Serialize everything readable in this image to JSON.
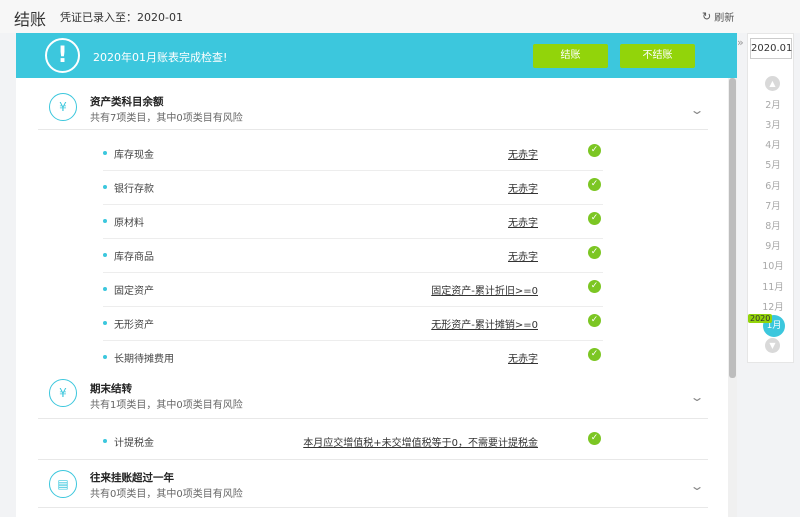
{
  "header": {
    "title": "结账",
    "voucher_info": "凭证已录入至：2020-01",
    "refresh_label": "刷新"
  },
  "banner": {
    "message": "2020年01月账表完成检查!",
    "close_label": "结账",
    "no_close_label": "不结账"
  },
  "sections": [
    {
      "title": "资产类科目余额",
      "subtitle": "共有7项类目，其中0项类目有风险",
      "icon": "yen-icon",
      "items": [
        {
          "name": "库存现金",
          "result": "无赤字"
        },
        {
          "name": "银行存款",
          "result": "无赤字"
        },
        {
          "name": "原材料",
          "result": "无赤字"
        },
        {
          "name": "库存商品",
          "result": "无赤字"
        },
        {
          "name": "固定资产",
          "result": "固定资产-累计折旧>=0"
        },
        {
          "name": "无形资产",
          "result": "无形资产-累计摊销>=0"
        },
        {
          "name": "长期待摊费用",
          "result": "无赤字"
        }
      ]
    },
    {
      "title": "期末结转",
      "subtitle": "共有1项类目，其中0项类目有风险",
      "icon": "transfer-icon",
      "items": [
        {
          "name": "计提税金",
          "result": "本月应交增值税+未交增值税等于0，不需要计提税金"
        }
      ]
    },
    {
      "title": "往来挂账超过一年",
      "subtitle": "共有0项类目，其中0项类目有风险",
      "icon": "ledger-icon",
      "items": []
    }
  ],
  "period_nav": {
    "year_value": "2020.01",
    "months": [
      "2月",
      "3月",
      "4月",
      "5月",
      "6月",
      "7月",
      "8月",
      "9月",
      "10月",
      "11月",
      "12月"
    ],
    "current_month": "1月",
    "current_year_tag": "2020"
  },
  "colors": {
    "accent": "#3cc7dd",
    "button_green": "#92d40a",
    "check_green": "#7cc623"
  }
}
